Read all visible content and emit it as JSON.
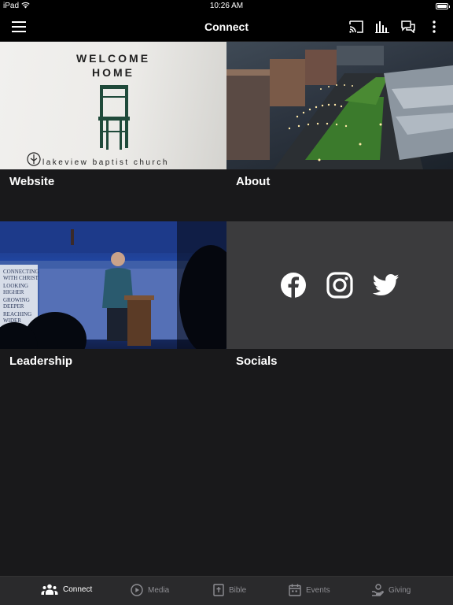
{
  "status_bar": {
    "carrier": "iPad",
    "time": "10:26 AM",
    "battery_level": 0.9
  },
  "header": {
    "title": "Connect"
  },
  "icons": {
    "menu": "menu-icon",
    "cast": "cast-icon",
    "audio": "audio-bars-icon",
    "chat": "chat-icon",
    "more": "more-vertical-icon"
  },
  "tiles": [
    {
      "label": "Website",
      "image_title_1": "WELCOME",
      "image_title_2": "HOME",
      "image_caption": "lakeview baptist church"
    },
    {
      "label": "About"
    },
    {
      "label": "Leadership",
      "banner_lines": [
        "CONNECTING WITH CHRIST",
        "LOOKING HIGHER",
        "GROWING DEEPER",
        "REACHING WIDER"
      ]
    },
    {
      "label": "Socials",
      "icons": [
        "facebook-icon",
        "instagram-icon",
        "twitter-icon"
      ]
    }
  ],
  "nav": [
    {
      "label": "Connect",
      "icon": "people-icon",
      "active": true
    },
    {
      "label": "Media",
      "icon": "play-circle-icon",
      "active": false
    },
    {
      "label": "Bible",
      "icon": "bible-icon",
      "active": false
    },
    {
      "label": "Events",
      "icon": "calendar-icon",
      "active": false
    },
    {
      "label": "Giving",
      "icon": "giving-hand-icon",
      "active": false
    }
  ],
  "colors": {
    "background": "#19191b",
    "bar": "#000000",
    "nav_bg": "#2a2a2c",
    "nav_inactive": "#8e8e93",
    "socials_bg": "#3b3b3d"
  }
}
